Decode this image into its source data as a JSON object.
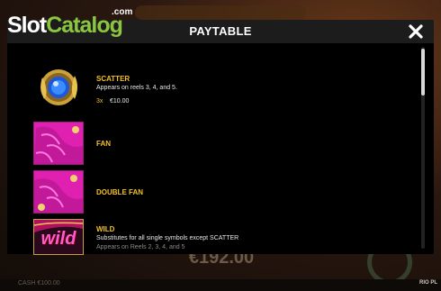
{
  "logo": {
    "slot": "Slot",
    "catalog": "Catalog",
    "com": ".com"
  },
  "background": {
    "big_value": "€192.00",
    "footer_left": "CASH  €100.00",
    "footer_right": "RIO PL"
  },
  "modal": {
    "title": "PAYTABLE",
    "close_icon": "close-icon"
  },
  "symbols": [
    {
      "name": "SCATTER",
      "description": "Appears on reels 3, 4, and 5.",
      "pay": {
        "multiplier": "3x",
        "value": "€10.00"
      },
      "icon": "blue-gem-medallion-icon"
    },
    {
      "name": "FAN",
      "icon": "pink-fan-icon"
    },
    {
      "name": "DOUBLE FAN",
      "icon": "pink-double-fan-icon"
    },
    {
      "name": "WILD",
      "description": "Substitutes for all single symbols except SCATTER",
      "description2": "Appears on Reels 2, 3, 4, and 5",
      "icon": "wild-icon",
      "icon_text": "wild"
    }
  ],
  "colors": {
    "accent": "#f2c027",
    "logo_green": "#8cc63e",
    "header": "#1c1c1c",
    "fan_pink": "#e020b0"
  }
}
